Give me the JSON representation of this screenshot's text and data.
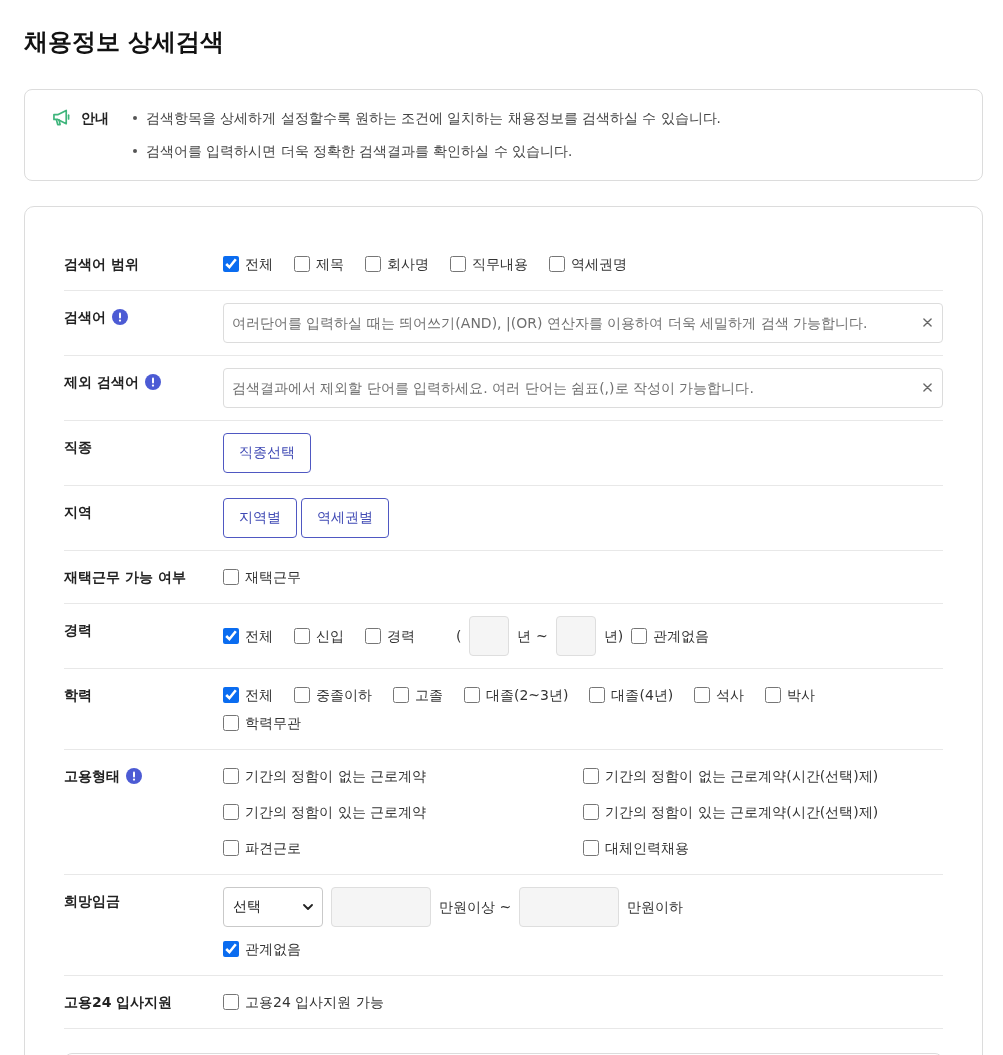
{
  "page_title": "채용정보 상세검색",
  "notice": {
    "label": "안내",
    "items": [
      "검색항목을 상세하게 설정할수록 원하는 조건에 일치하는 채용정보를 검색하실 수 있습니다.",
      "검색어를 입력하시면 더욱 정확한 검색결과를 확인하실 수 있습니다."
    ]
  },
  "form": {
    "rows": [
      {
        "kind": "checkboxes",
        "label": "검색어 범위",
        "info": false,
        "options": [
          {
            "label": "전체",
            "checked": true
          },
          {
            "label": "제목",
            "checked": false
          },
          {
            "label": "회사명",
            "checked": false
          },
          {
            "label": "직무내용",
            "checked": false
          },
          {
            "label": "역세권명",
            "checked": false
          }
        ]
      },
      {
        "kind": "text_input",
        "label": "검색어",
        "info": true,
        "placeholder": "여러단어를 입력하실 때는 띄어쓰기(AND), |(OR) 연산자를 이용하여 더욱 세밀하게 검색 가능합니다."
      },
      {
        "kind": "text_input",
        "label": "제외 검색어",
        "info": true,
        "placeholder": "검색결과에서 제외할 단어를 입력하세요. 여러 단어는 쉼표(,)로 작성이 가능합니다."
      },
      {
        "kind": "buttons",
        "label": "직종",
        "info": false,
        "buttons": [
          "직종선택"
        ]
      },
      {
        "kind": "buttons",
        "label": "지역",
        "info": false,
        "buttons": [
          "지역별",
          "역세권별"
        ]
      },
      {
        "kind": "checkboxes",
        "label": "재택근무 가능 여부",
        "info": false,
        "options": [
          {
            "label": "재택근무",
            "checked": false
          }
        ]
      },
      {
        "kind": "career",
        "label": "경력",
        "info": false,
        "options": [
          {
            "label": "전체",
            "checked": true
          },
          {
            "label": "신입",
            "checked": false
          },
          {
            "label": "경력",
            "checked": false
          }
        ],
        "range": {
          "prefix": "(",
          "from_suffix": "년 ~",
          "to_suffix": "년)"
        },
        "extra_option": {
          "label": "관계없음",
          "checked": false
        }
      },
      {
        "kind": "checkboxes",
        "label": "학력",
        "info": false,
        "options": [
          {
            "label": "전체",
            "checked": true
          },
          {
            "label": "중졸이하",
            "checked": false
          },
          {
            "label": "고졸",
            "checked": false
          },
          {
            "label": "대졸(2~3년)",
            "checked": false
          },
          {
            "label": "대졸(4년)",
            "checked": false
          },
          {
            "label": "석사",
            "checked": false
          },
          {
            "label": "박사",
            "checked": false
          },
          {
            "label": "학력무관",
            "checked": false
          }
        ]
      },
      {
        "kind": "checkbox_grid",
        "label": "고용형태",
        "info": true,
        "options": [
          {
            "label": "기간의 정함이 없는 근로계약",
            "checked": false
          },
          {
            "label": "기간의 정함이 없는 근로계약(시간(선택)제)",
            "checked": false
          },
          {
            "label": "기간의 정함이 있는 근로계약",
            "checked": false
          },
          {
            "label": "기간의 정함이 있는 근로계약(시간(선택)제)",
            "checked": false
          },
          {
            "label": "파견근로",
            "checked": false
          },
          {
            "label": "대체인력채용",
            "checked": false
          }
        ]
      },
      {
        "kind": "salary",
        "label": "희망임금",
        "info": false,
        "select": {
          "value": "선택"
        },
        "min_suffix": "만원이상 ~",
        "max_suffix": "만원이하",
        "option": {
          "label": "관계없음",
          "checked": true
        }
      },
      {
        "kind": "checkboxes",
        "label": "고용24 입사지원",
        "info": false,
        "options": [
          {
            "label": "고용24 입사지원 가능",
            "checked": false
          }
        ]
      }
    ]
  }
}
